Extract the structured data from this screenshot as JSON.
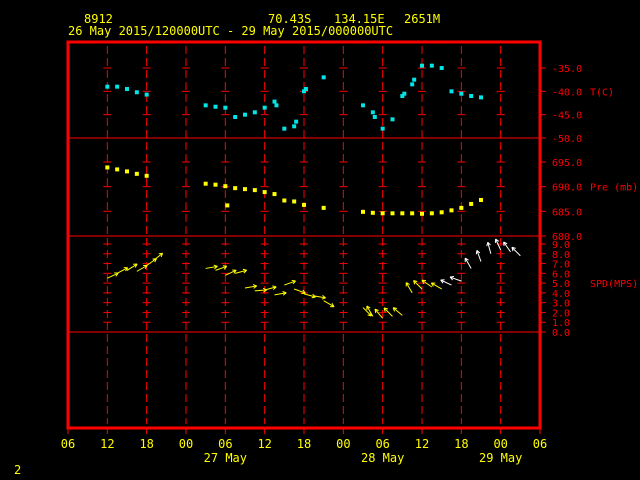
{
  "header": {
    "station_id": "8912",
    "latitude": "70.43S",
    "longitude": "134.15E",
    "elevation": "2651M",
    "time_range": "26 May 2015/120000UTC - 29 May 2015/000000UTC"
  },
  "frame_number": "2",
  "colors": {
    "frame": "#ff0000",
    "grid": "#ff0000",
    "header_text": "#ffff00",
    "axis_labels": "#ff0000",
    "temperature": "#00e5e5",
    "pressure": "#ffff00",
    "wind_arrows": "#ffff00",
    "wind_arrows_late": "#ffffff"
  },
  "chart_data": {
    "type": "scatter",
    "x_axis": {
      "unit": "hours since 26 May 2015 06UTC",
      "range": [
        0,
        72
      ],
      "ticks": [
        0,
        6,
        12,
        18,
        24,
        30,
        36,
        42,
        48,
        54,
        60,
        66,
        72
      ],
      "tick_labels": [
        "06",
        "12",
        "18",
        "00",
        "06",
        "12",
        "18",
        "00",
        "06",
        "12",
        "18",
        "00",
        "06"
      ],
      "date_labels": [
        {
          "x": 24,
          "text": "27 May"
        },
        {
          "x": 48,
          "text": "28 May"
        },
        {
          "x": 66,
          "text": "29 May"
        }
      ]
    },
    "panels": [
      {
        "name": "temperature",
        "label": "T(C)",
        "ylim": [
          -50,
          -30
        ],
        "ticks": [
          -50,
          -45,
          -40,
          -35
        ],
        "tick_labels": [
          "-50.0",
          "-45.0",
          "-40.0",
          "-35.0"
        ],
        "series": [
          {
            "points": [
              [
                6,
                -39
              ],
              [
                7.5,
                -39
              ],
              [
                9,
                -39.5
              ],
              [
                10.5,
                -40.2
              ],
              [
                12,
                -40.7
              ],
              [
                21,
                -43
              ],
              [
                22.5,
                -43.3
              ],
              [
                24,
                -43.5
              ],
              [
                25.5,
                -45.5
              ],
              [
                27,
                -45
              ],
              [
                28.5,
                -44.5
              ],
              [
                30,
                -43.5
              ],
              [
                31.5,
                -42.2
              ],
              [
                31.8,
                -43
              ],
              [
                33,
                -48
              ],
              [
                34.5,
                -47.5
              ],
              [
                34.8,
                -46.5
              ],
              [
                36,
                -40
              ],
              [
                36.3,
                -39.5
              ],
              [
                39,
                -37
              ],
              [
                45,
                -43
              ],
              [
                46.5,
                -44.5
              ],
              [
                46.8,
                -45.5
              ],
              [
                48,
                -48
              ],
              [
                49.5,
                -46
              ],
              [
                51,
                -41
              ],
              [
                51.3,
                -40.5
              ],
              [
                52.5,
                -38.5
              ],
              [
                52.8,
                -37.5
              ],
              [
                54,
                -34.5
              ],
              [
                55.5,
                -34.5
              ],
              [
                57,
                -35
              ],
              [
                58.5,
                -40
              ],
              [
                60,
                -40.5
              ],
              [
                61.5,
                -41
              ],
              [
                63,
                -41.3
              ]
            ]
          }
        ]
      },
      {
        "name": "pressure",
        "label": "Pre (mb)",
        "ylim": [
          680,
          698
        ],
        "ticks": [
          680,
          685,
          690,
          695
        ],
        "tick_labels": [
          "680.0",
          "685.0",
          "690.0",
          "695.0"
        ],
        "series": [
          {
            "points": [
              [
                6,
                693.9
              ],
              [
                7.5,
                693.5
              ],
              [
                9,
                693.1
              ],
              [
                10.5,
                692.6
              ],
              [
                12,
                692.2
              ],
              [
                21,
                690.6
              ],
              [
                22.5,
                690.4
              ],
              [
                24,
                690.1
              ],
              [
                24.3,
                686.2
              ],
              [
                25.5,
                689.7
              ],
              [
                27,
                689.5
              ],
              [
                28.5,
                689.3
              ],
              [
                30,
                688.9
              ],
              [
                31.5,
                688.5
              ],
              [
                33,
                687.2
              ],
              [
                34.5,
                687
              ],
              [
                36,
                686.3
              ],
              [
                39,
                685.7
              ],
              [
                45,
                684.9
              ],
              [
                46.5,
                684.7
              ],
              [
                48,
                684.6
              ],
              [
                49.5,
                684.6
              ],
              [
                51,
                684.6
              ],
              [
                52.5,
                684.6
              ],
              [
                54,
                684.5
              ],
              [
                55.5,
                684.6
              ],
              [
                57,
                684.8
              ],
              [
                58.5,
                685.2
              ],
              [
                60,
                685.7
              ],
              [
                61.5,
                686.5
              ],
              [
                63,
                687.3
              ]
            ]
          }
        ]
      },
      {
        "name": "wind",
        "label": "SPD(MPS)",
        "ylim": [
          0,
          9
        ],
        "ticks": [
          0,
          1,
          2,
          3,
          4,
          5,
          6,
          7,
          8,
          9
        ],
        "tick_labels": [
          "0.0",
          "1.0",
          "2.0",
          "3.0",
          "4.0",
          "5.0",
          "6.0",
          "7.0",
          "8.0",
          "9.0"
        ],
        "series": [
          {
            "points": [
              [
                6,
                5.5,
                65
              ],
              [
                7.5,
                6,
                62
              ],
              [
                9,
                6.3,
                58
              ],
              [
                10.5,
                6.2,
                60
              ],
              [
                12,
                6.8,
                55
              ],
              [
                13,
                7.3,
                52
              ],
              [
                21,
                6.5,
                80
              ],
              [
                22.5,
                6.3,
                70
              ],
              [
                24,
                5.8,
                65
              ],
              [
                25.5,
                6,
                75
              ],
              [
                27,
                4.5,
                80
              ],
              [
                28.5,
                4.2,
                85
              ],
              [
                30,
                4.3,
                75
              ],
              [
                31.5,
                3.8,
                80
              ],
              [
                33,
                4.8,
                70
              ],
              [
                34.5,
                4.4,
                110
              ],
              [
                36,
                3.9,
                105
              ],
              [
                37.5,
                3.7,
                100
              ],
              [
                39,
                3.2,
                120
              ],
              [
                45,
                2.5,
                135
              ],
              [
                46.5,
                1.6,
                -30
              ],
              [
                48,
                1.4,
                -40
              ],
              [
                49.5,
                1.6,
                -45
              ],
              [
                51,
                1.7,
                -50
              ],
              [
                52.5,
                4,
                -30
              ],
              [
                54,
                4.4,
                -45
              ],
              [
                55.5,
                4.6,
                -55
              ],
              [
                57,
                4.4,
                -60
              ],
              [
                58.5,
                4.8,
                -65
              ],
              [
                60,
                5.2,
                -70
              ],
              [
                61.5,
                6.5,
                -30
              ],
              [
                63,
                7.2,
                -20
              ],
              [
                64.5,
                8,
                -15
              ],
              [
                66,
                8.4,
                -25
              ],
              [
                67.5,
                8.2,
                -35
              ],
              [
                69,
                7.8,
                -45
              ]
            ]
          }
        ]
      }
    ]
  }
}
